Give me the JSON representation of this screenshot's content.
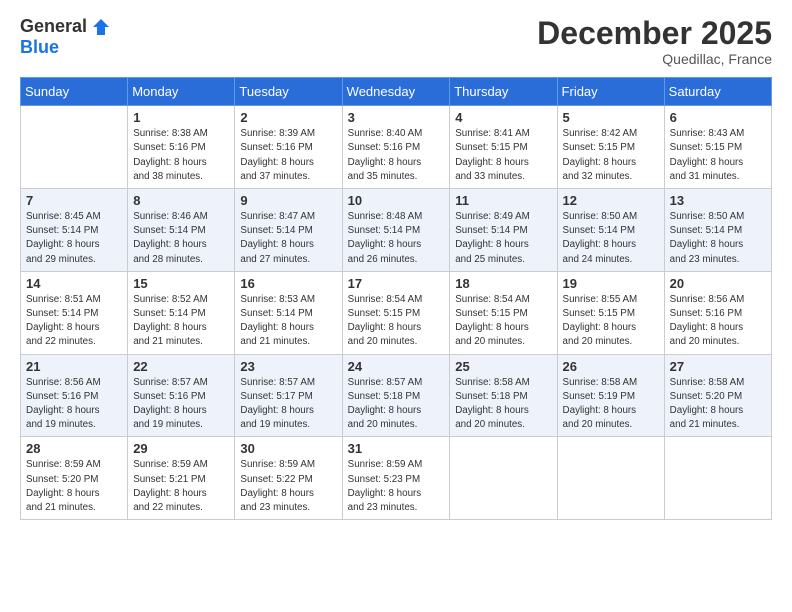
{
  "logo": {
    "general": "General",
    "blue": "Blue"
  },
  "title": "December 2025",
  "location": "Quedillac, France",
  "weekdays": [
    "Sunday",
    "Monday",
    "Tuesday",
    "Wednesday",
    "Thursday",
    "Friday",
    "Saturday"
  ],
  "weeks": [
    [
      {
        "day": "",
        "info": ""
      },
      {
        "day": "1",
        "info": "Sunrise: 8:38 AM\nSunset: 5:16 PM\nDaylight: 8 hours\nand 38 minutes."
      },
      {
        "day": "2",
        "info": "Sunrise: 8:39 AM\nSunset: 5:16 PM\nDaylight: 8 hours\nand 37 minutes."
      },
      {
        "day": "3",
        "info": "Sunrise: 8:40 AM\nSunset: 5:16 PM\nDaylight: 8 hours\nand 35 minutes."
      },
      {
        "day": "4",
        "info": "Sunrise: 8:41 AM\nSunset: 5:15 PM\nDaylight: 8 hours\nand 33 minutes."
      },
      {
        "day": "5",
        "info": "Sunrise: 8:42 AM\nSunset: 5:15 PM\nDaylight: 8 hours\nand 32 minutes."
      },
      {
        "day": "6",
        "info": "Sunrise: 8:43 AM\nSunset: 5:15 PM\nDaylight: 8 hours\nand 31 minutes."
      }
    ],
    [
      {
        "day": "7",
        "info": "Sunrise: 8:45 AM\nSunset: 5:14 PM\nDaylight: 8 hours\nand 29 minutes."
      },
      {
        "day": "8",
        "info": "Sunrise: 8:46 AM\nSunset: 5:14 PM\nDaylight: 8 hours\nand 28 minutes."
      },
      {
        "day": "9",
        "info": "Sunrise: 8:47 AM\nSunset: 5:14 PM\nDaylight: 8 hours\nand 27 minutes."
      },
      {
        "day": "10",
        "info": "Sunrise: 8:48 AM\nSunset: 5:14 PM\nDaylight: 8 hours\nand 26 minutes."
      },
      {
        "day": "11",
        "info": "Sunrise: 8:49 AM\nSunset: 5:14 PM\nDaylight: 8 hours\nand 25 minutes."
      },
      {
        "day": "12",
        "info": "Sunrise: 8:50 AM\nSunset: 5:14 PM\nDaylight: 8 hours\nand 24 minutes."
      },
      {
        "day": "13",
        "info": "Sunrise: 8:50 AM\nSunset: 5:14 PM\nDaylight: 8 hours\nand 23 minutes."
      }
    ],
    [
      {
        "day": "14",
        "info": "Sunrise: 8:51 AM\nSunset: 5:14 PM\nDaylight: 8 hours\nand 22 minutes."
      },
      {
        "day": "15",
        "info": "Sunrise: 8:52 AM\nSunset: 5:14 PM\nDaylight: 8 hours\nand 21 minutes."
      },
      {
        "day": "16",
        "info": "Sunrise: 8:53 AM\nSunset: 5:14 PM\nDaylight: 8 hours\nand 21 minutes."
      },
      {
        "day": "17",
        "info": "Sunrise: 8:54 AM\nSunset: 5:15 PM\nDaylight: 8 hours\nand 20 minutes."
      },
      {
        "day": "18",
        "info": "Sunrise: 8:54 AM\nSunset: 5:15 PM\nDaylight: 8 hours\nand 20 minutes."
      },
      {
        "day": "19",
        "info": "Sunrise: 8:55 AM\nSunset: 5:15 PM\nDaylight: 8 hours\nand 20 minutes."
      },
      {
        "day": "20",
        "info": "Sunrise: 8:56 AM\nSunset: 5:16 PM\nDaylight: 8 hours\nand 20 minutes."
      }
    ],
    [
      {
        "day": "21",
        "info": "Sunrise: 8:56 AM\nSunset: 5:16 PM\nDaylight: 8 hours\nand 19 minutes."
      },
      {
        "day": "22",
        "info": "Sunrise: 8:57 AM\nSunset: 5:16 PM\nDaylight: 8 hours\nand 19 minutes."
      },
      {
        "day": "23",
        "info": "Sunrise: 8:57 AM\nSunset: 5:17 PM\nDaylight: 8 hours\nand 19 minutes."
      },
      {
        "day": "24",
        "info": "Sunrise: 8:57 AM\nSunset: 5:18 PM\nDaylight: 8 hours\nand 20 minutes."
      },
      {
        "day": "25",
        "info": "Sunrise: 8:58 AM\nSunset: 5:18 PM\nDaylight: 8 hours\nand 20 minutes."
      },
      {
        "day": "26",
        "info": "Sunrise: 8:58 AM\nSunset: 5:19 PM\nDaylight: 8 hours\nand 20 minutes."
      },
      {
        "day": "27",
        "info": "Sunrise: 8:58 AM\nSunset: 5:20 PM\nDaylight: 8 hours\nand 21 minutes."
      }
    ],
    [
      {
        "day": "28",
        "info": "Sunrise: 8:59 AM\nSunset: 5:20 PM\nDaylight: 8 hours\nand 21 minutes."
      },
      {
        "day": "29",
        "info": "Sunrise: 8:59 AM\nSunset: 5:21 PM\nDaylight: 8 hours\nand 22 minutes."
      },
      {
        "day": "30",
        "info": "Sunrise: 8:59 AM\nSunset: 5:22 PM\nDaylight: 8 hours\nand 23 minutes."
      },
      {
        "day": "31",
        "info": "Sunrise: 8:59 AM\nSunset: 5:23 PM\nDaylight: 8 hours\nand 23 minutes."
      },
      {
        "day": "",
        "info": ""
      },
      {
        "day": "",
        "info": ""
      },
      {
        "day": "",
        "info": ""
      }
    ]
  ]
}
